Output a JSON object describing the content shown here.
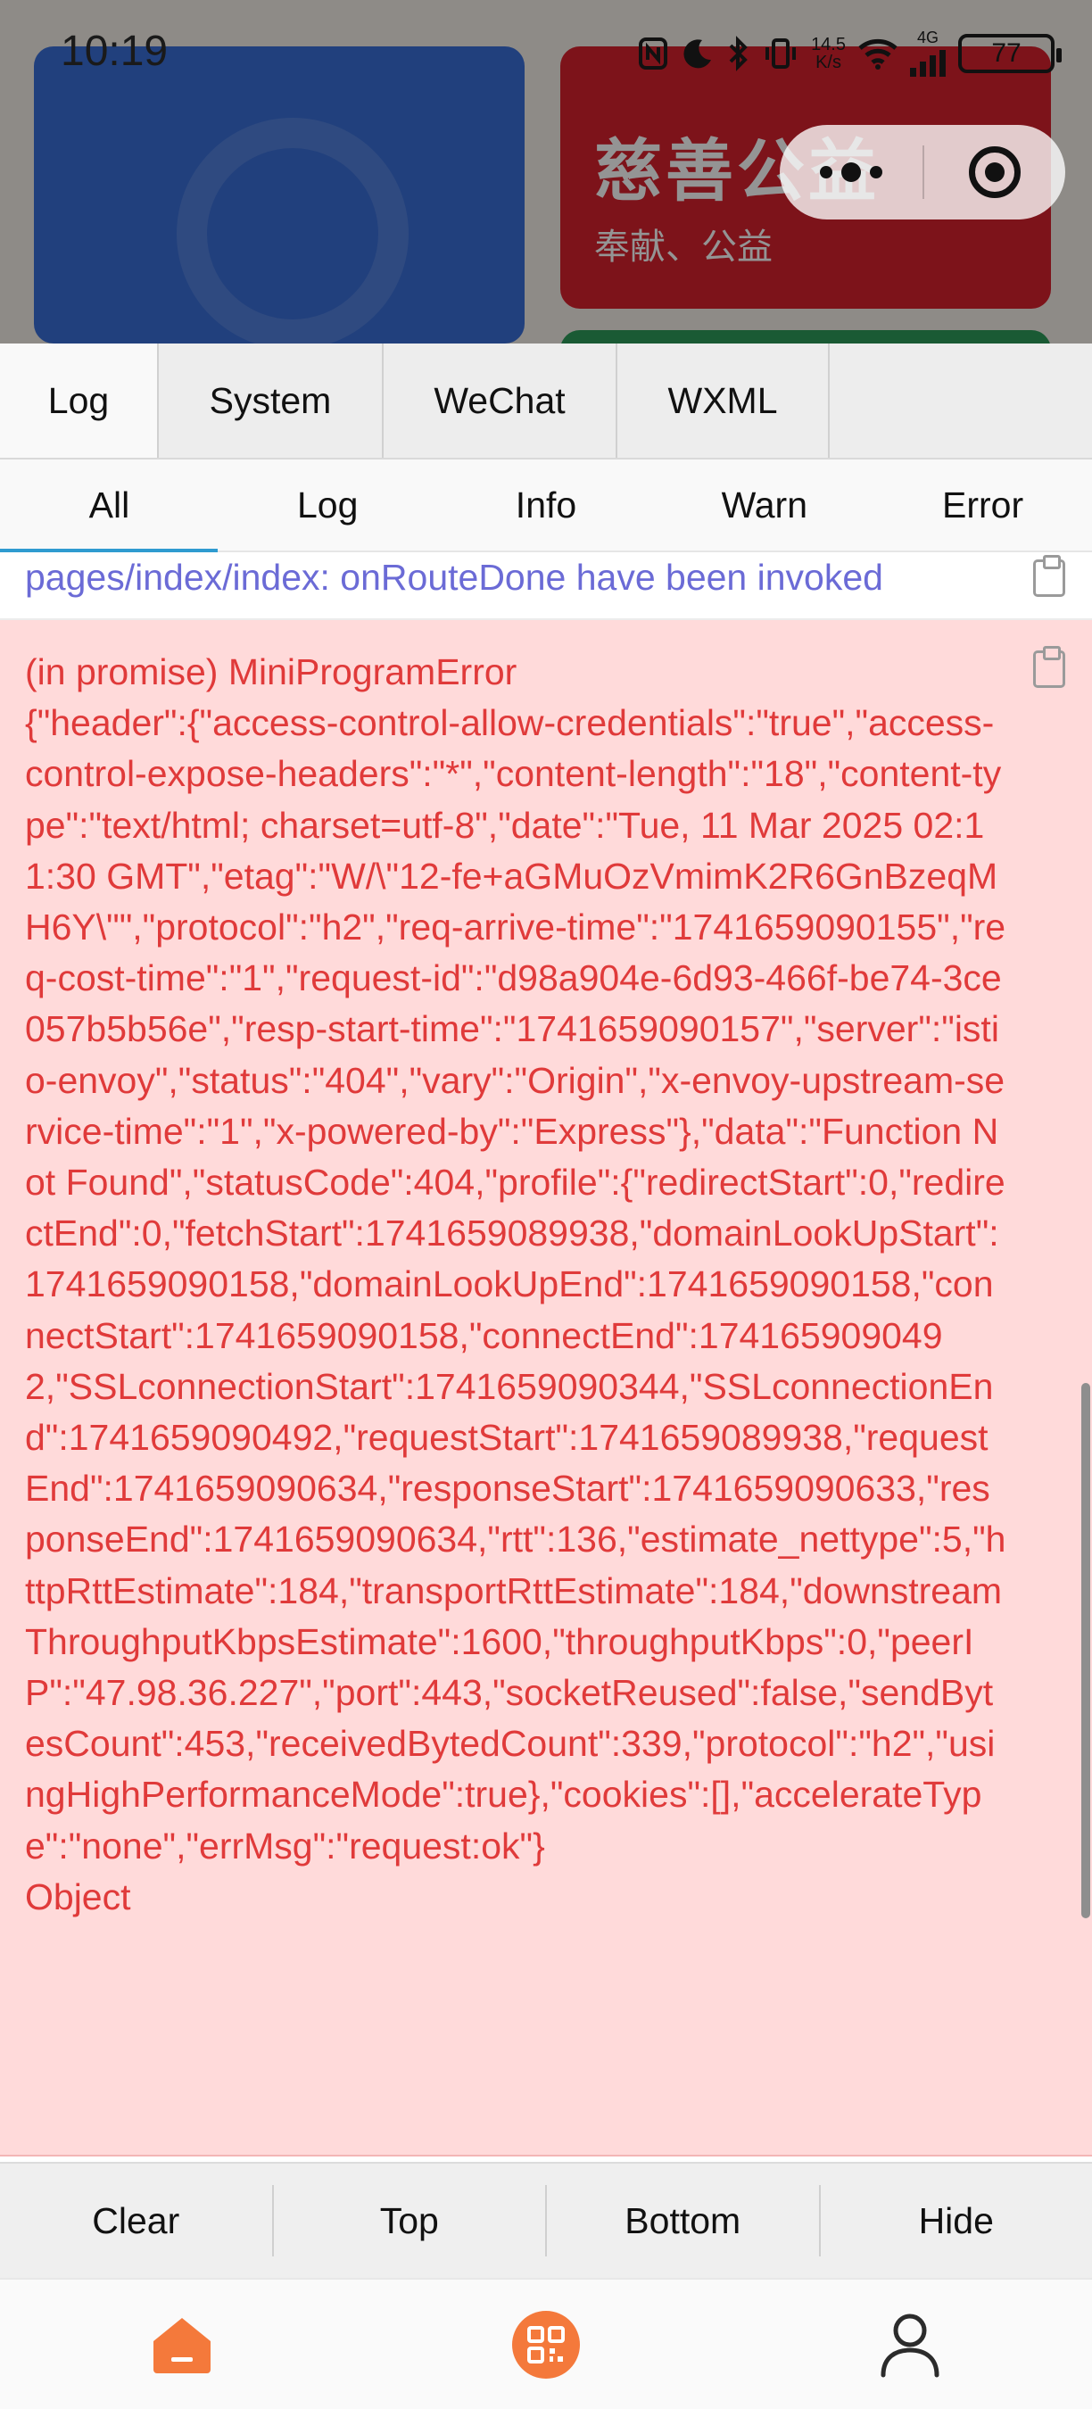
{
  "status_bar": {
    "time": "10:19",
    "net_speed_value": "14.5",
    "net_speed_unit": "K/s",
    "network_type": "4G",
    "battery": "77"
  },
  "background_app": {
    "card_title": "慈善公益",
    "card_subtitle": "奉献、公益",
    "colors": {
      "blue_card": "#3a6fd8",
      "red_card": "#d7212e",
      "green_card": "#2e9b5b"
    }
  },
  "capsule": {
    "more_icon": "more-dots-icon",
    "close_icon": "target-close-icon"
  },
  "console": {
    "main_tabs": [
      {
        "label": "Log",
        "active": true
      },
      {
        "label": "System",
        "active": false
      },
      {
        "label": "WeChat",
        "active": false
      },
      {
        "label": "WXML",
        "active": false
      }
    ],
    "sub_tabs": [
      {
        "label": "All",
        "active": true
      },
      {
        "label": "Log",
        "active": false
      },
      {
        "label": "Info",
        "active": false
      },
      {
        "label": "Warn",
        "active": false
      },
      {
        "label": "Error",
        "active": false
      }
    ],
    "logs": [
      {
        "level": "info",
        "text": "pages/index/index: onRouteDone have been invoked"
      },
      {
        "level": "error",
        "text": "(in promise) MiniProgramError\n{\"header\":{\"access-control-allow-credentials\":\"true\",\"access-control-expose-headers\":\"*\",\"content-length\":\"18\",\"content-type\":\"text/html; charset=utf-8\",\"date\":\"Tue, 11 Mar 2025 02:11:30 GMT\",\"etag\":\"W/\\\"12-fe+aGMuOzVmimK2R6GnBzeqMH6Y\\\"\",\"protocol\":\"h2\",\"req-arrive-time\":\"1741659090155\",\"req-cost-time\":\"1\",\"request-id\":\"d98a904e-6d93-466f-be74-3ce057b5b56e\",\"resp-start-time\":\"1741659090157\",\"server\":\"istio-envoy\",\"status\":\"404\",\"vary\":\"Origin\",\"x-envoy-upstream-service-time\":\"1\",\"x-powered-by\":\"Express\"},\"data\":\"Function Not Found\",\"statusCode\":404,\"profile\":{\"redirectStart\":0,\"redirectEnd\":0,\"fetchStart\":1741659089938,\"domainLookUpStart\":1741659090158,\"domainLookUpEnd\":1741659090158,\"connectStart\":1741659090158,\"connectEnd\":1741659090492,\"SSLconnectionStart\":1741659090344,\"SSLconnectionEnd\":1741659090492,\"requestStart\":1741659089938,\"requestEnd\":1741659090634,\"responseStart\":1741659090633,\"responseEnd\":1741659090634,\"rtt\":136,\"estimate_nettype\":5,\"httpRttEstimate\":184,\"transportRttEstimate\":184,\"downstreamThroughputKbpsEstimate\":1600,\"throughputKbps\":0,\"peerIP\":\"47.98.36.227\",\"port\":443,\"socketReused\":false,\"sendBytesCount\":453,\"receivedBytedCount\":339,\"protocol\":\"h2\",\"usingHighPerformanceMode\":true},\"cookies\":[],\"accelerateType\":\"none\",\"errMsg\":\"request:ok\"}\nObject"
      }
    ],
    "tool_bar": {
      "clear": "Clear",
      "top": "Top",
      "bottom": "Bottom",
      "hide": "Hide"
    },
    "colors": {
      "error_bg": "#ffdada",
      "error_text": "#e03a3a",
      "info_text": "#6b6bd6",
      "tab_indicator": "#2f9bd0"
    }
  },
  "bottom_nav": {
    "items": [
      {
        "icon": "home-icon",
        "active": true
      },
      {
        "icon": "qr-code-icon",
        "active": false
      },
      {
        "icon": "user-icon",
        "active": false
      }
    ],
    "accent_color": "#f4793b"
  }
}
